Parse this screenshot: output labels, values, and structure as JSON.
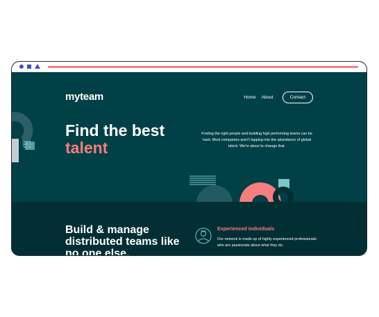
{
  "site": {
    "logo": "myteam",
    "nav": {
      "home": "Home",
      "about": "About",
      "contact": "Contact"
    }
  },
  "hero": {
    "headline_line1": "Find the best",
    "headline_line2": "talent",
    "body": "Finding the right people and building high performing teams can be hard. Most companies aren't tapping into the abundance of global talent. We're about to change that."
  },
  "band": {
    "title": "Build & manage distributed teams like no one else.",
    "feature_title": "Experienced individuals",
    "feature_text": "Our network is made up of highly experienced professionals who are passionate about what they do."
  },
  "colors": {
    "bg_dark": "#004047",
    "bg_darker": "#012f34",
    "accent": "#f67e7e",
    "mint": "#79c8c7"
  }
}
